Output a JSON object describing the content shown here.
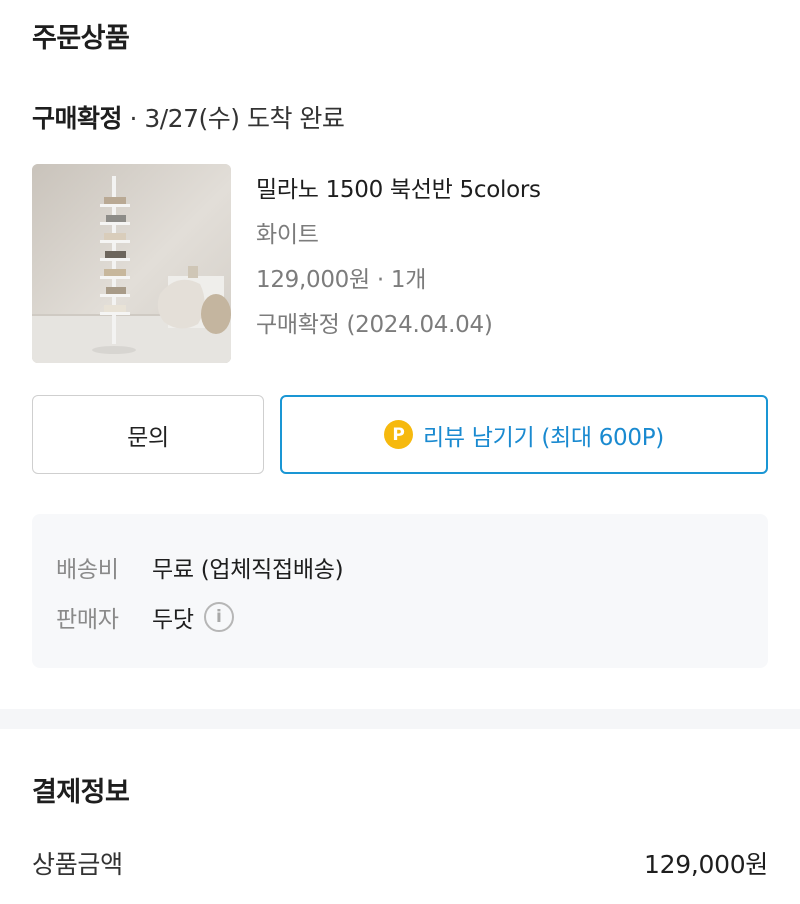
{
  "order": {
    "section_title": "주문상품",
    "status": {
      "label": "구매확정",
      "detail": " · 3/27(수) 도착 완료"
    },
    "product": {
      "image_icon": "product-photo-bookshelf",
      "name": "밀라노 1500 북선반 5colors",
      "option": "화이트",
      "price_qty": "129,000원 · 1개",
      "confirm_status": "구매확정 (2024.04.04)"
    },
    "actions": {
      "inquiry_label": "문의",
      "review_label": "리뷰 남기기 (최대 600P)",
      "point_badge": "P",
      "point_icon_color": "#f6b90e",
      "accent_color": "#1a96d4"
    },
    "info": {
      "shipping_label": "배송비",
      "shipping_value": "무료 (업체직접배송)",
      "seller_label": "판매자",
      "seller_value": "두닷",
      "seller_info_icon": "info-circle-icon"
    }
  },
  "payment": {
    "section_title": "결제정보",
    "product_amount_label": "상품금액",
    "product_amount_value": "129,000원"
  }
}
